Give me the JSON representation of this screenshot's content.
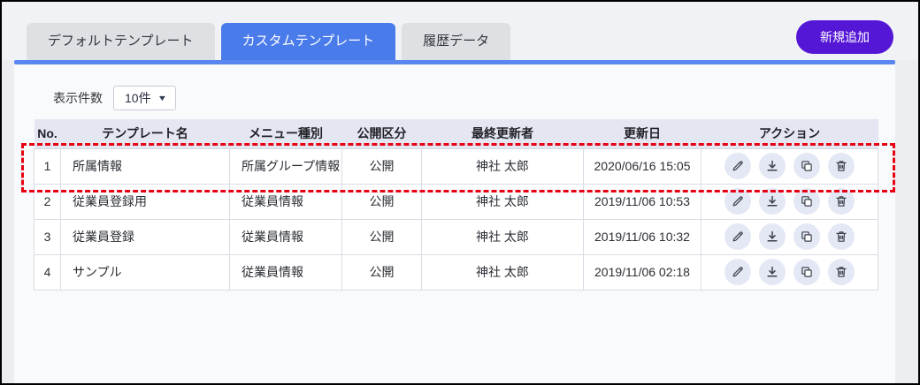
{
  "tabs": [
    {
      "name": "tab-default-template",
      "label": "デフォルトテンプレート",
      "active": false
    },
    {
      "name": "tab-custom-template",
      "label": "カスタムテンプレート",
      "active": true
    },
    {
      "name": "tab-history-data",
      "label": "履歴データ",
      "active": false
    }
  ],
  "toolbar": {
    "add_button_label": "新規追加"
  },
  "list_controls": {
    "page_size_label": "表示件数",
    "page_size_value": "10件",
    "caret_icon": "caret-down-icon"
  },
  "table": {
    "headers": [
      "No.",
      "テンプレート名",
      "メニュー種別",
      "公開区分",
      "最終更新者",
      "更新日",
      "アクション"
    ],
    "rows": [
      {
        "no": "1",
        "name": "所属情報",
        "menu_type": "所属グループ情報",
        "visibility": "公開",
        "updated_by": "神社 太郎",
        "updated_at": "2020/06/16 15:05",
        "highlighted": true
      },
      {
        "no": "2",
        "name": "従業員登録用",
        "menu_type": "従業員情報",
        "visibility": "公開",
        "updated_by": "神社 太郎",
        "updated_at": "2019/11/06 10:53",
        "highlighted": false
      },
      {
        "no": "3",
        "name": "従業員登録",
        "menu_type": "従業員情報",
        "visibility": "公開",
        "updated_by": "神社 太郎",
        "updated_at": "2019/11/06 10:32",
        "highlighted": false
      },
      {
        "no": "4",
        "name": "サンプル",
        "menu_type": "従業員情報",
        "visibility": "公開",
        "updated_by": "神社 太郎",
        "updated_at": "2019/11/06 02:18",
        "highlighted": false
      }
    ],
    "actions": [
      {
        "id": "edit-button",
        "icon": "pencil-icon"
      },
      {
        "id": "download-button",
        "icon": "download-icon"
      },
      {
        "id": "duplicate-button",
        "icon": "copy-icon"
      },
      {
        "id": "delete-button",
        "icon": "trash-icon"
      }
    ]
  },
  "colors": {
    "active_tab_blue": "#4a7bea",
    "tab_underline_blue": "#5a86f0",
    "add_button_purple": "#5517d6",
    "table_header_lavender": "#e4e6f2",
    "action_circle": "#e4e8f5",
    "highlight_red": "#e60012"
  }
}
